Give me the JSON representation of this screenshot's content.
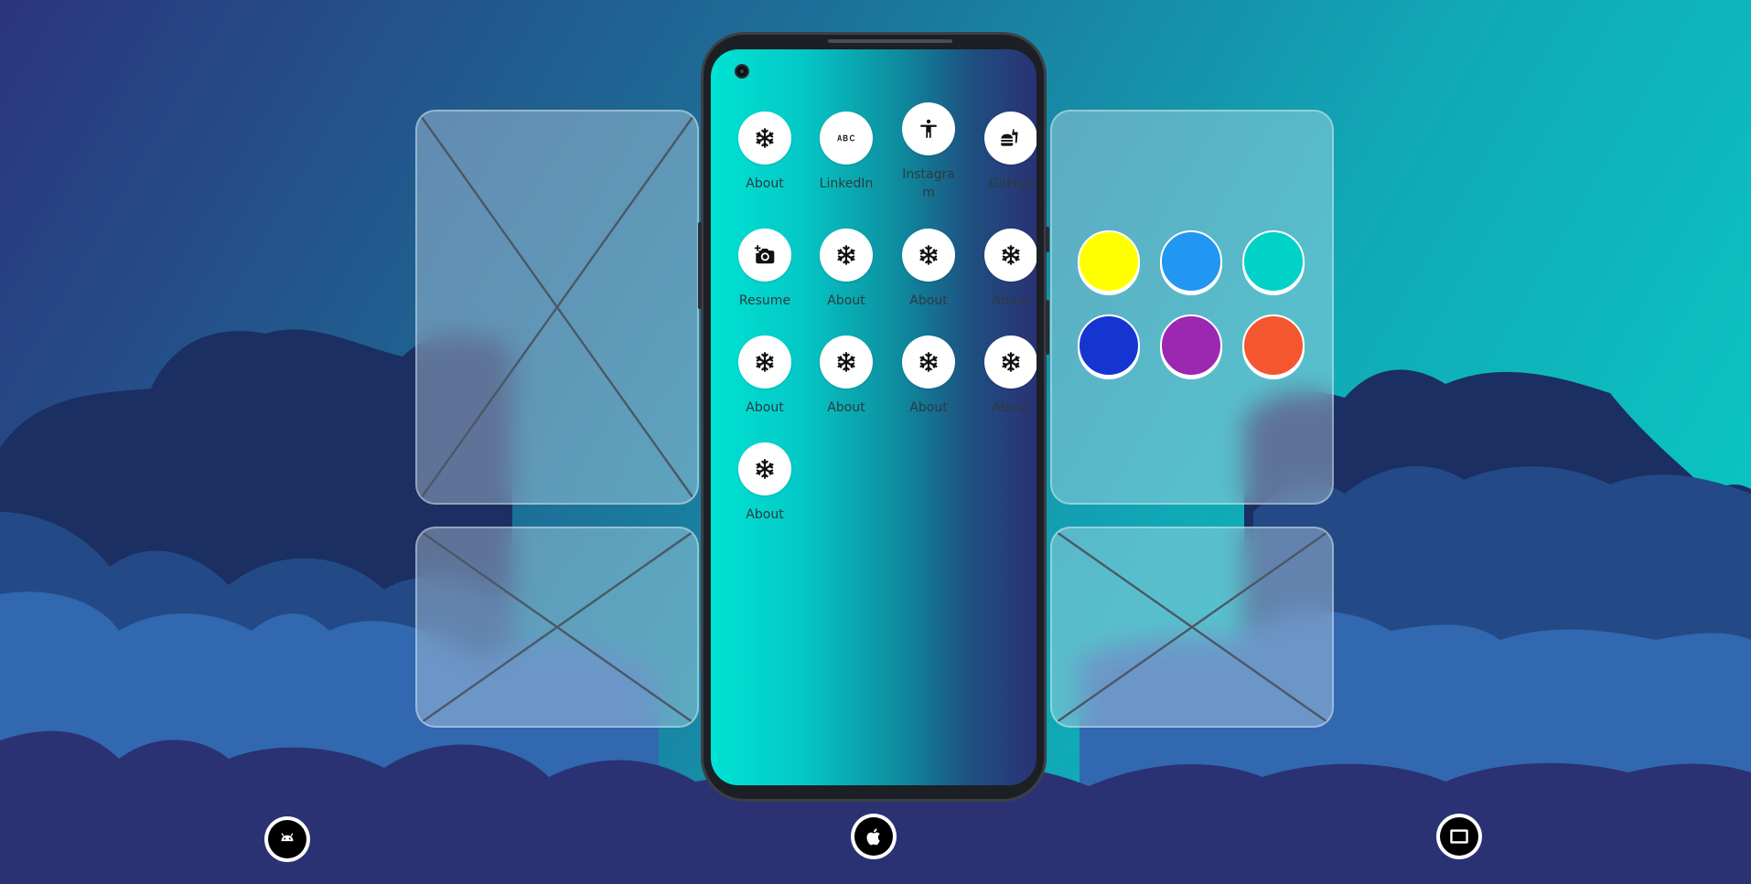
{
  "colors": {
    "phone_gradient": [
      "#00e3d3",
      "#2a3275"
    ],
    "cloud_dark": "#1b2f62",
    "cloud_mid": "#234a86",
    "cloud_light": "#3168b0",
    "cloud_bottom": "#2a3274"
  },
  "apps": [
    {
      "label": "About",
      "icon": "snowflake-icon"
    },
    {
      "label": "LinkedIn",
      "icon": "abc-text-icon"
    },
    {
      "label": "Instagram",
      "icon": "accessibility-person-icon"
    },
    {
      "label": "GitHub",
      "icon": "fastfood-icon"
    },
    {
      "label": "Resume",
      "icon": "add-camera-icon"
    },
    {
      "label": "About",
      "icon": "snowflake-icon"
    },
    {
      "label": "About",
      "icon": "snowflake-icon"
    },
    {
      "label": "About",
      "icon": "snowflake-icon"
    },
    {
      "label": "About",
      "icon": "snowflake-icon"
    },
    {
      "label": "About",
      "icon": "snowflake-icon"
    },
    {
      "label": "About",
      "icon": "snowflake-icon"
    },
    {
      "label": "About",
      "icon": "snowflake-icon"
    },
    {
      "label": "About",
      "icon": "snowflake-icon"
    }
  ],
  "color_swatches": [
    {
      "name": "yellow",
      "color": "#ffff00"
    },
    {
      "name": "blue",
      "color": "#2196f3"
    },
    {
      "name": "teal",
      "color": "#00d2c8"
    },
    {
      "name": "dark-blue",
      "color": "#1535d0"
    },
    {
      "name": "purple",
      "color": "#9c27b0"
    },
    {
      "name": "orange",
      "color": "#f4572f"
    }
  ],
  "nav": [
    {
      "name": "android",
      "icon": "android-icon"
    },
    {
      "name": "apple",
      "icon": "apple-icon"
    },
    {
      "name": "tablet",
      "icon": "tablet-icon"
    }
  ]
}
